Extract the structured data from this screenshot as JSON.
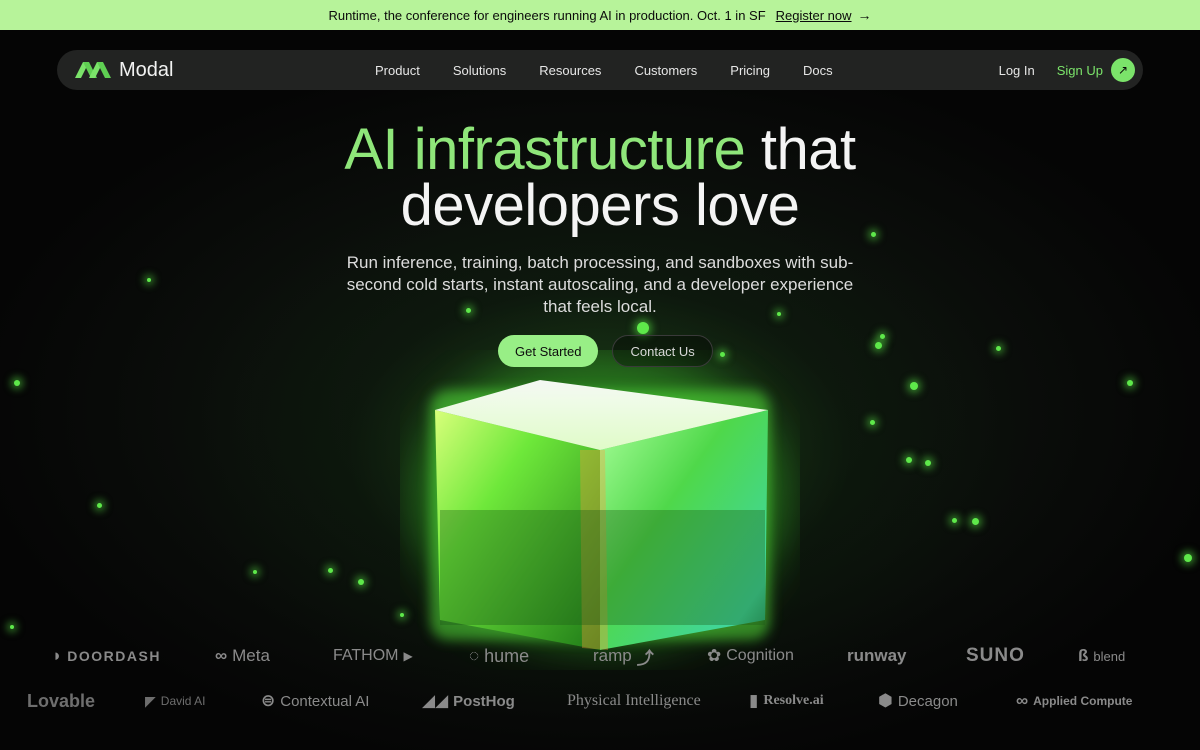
{
  "banner": {
    "text": "Runtime, the conference for engineers running AI in production. Oct. 1 in SF",
    "link": "Register now",
    "arrow_icon": "arrow-right-icon"
  },
  "nav": {
    "brand": "Modal",
    "links": [
      "Product",
      "Solutions",
      "Resources",
      "Customers",
      "Pricing",
      "Docs"
    ],
    "login": "Log In",
    "signup": "Sign Up"
  },
  "hero": {
    "title_accent": "AI infrastructure",
    "title_plain_1": "that",
    "title_plain_2": "developers love",
    "subtitle": "Run inference, training, batch processing, and sandboxes with sub-second cold starts, instant autoscaling, and a developer experience that feels local.",
    "primary_cta": "Get Started",
    "secondary_cta": "Contact Us"
  },
  "customers_row1": [
    "DOORDASH",
    "Meta",
    "FATHOM",
    "hume",
    "ramp",
    "Cognition",
    "runway",
    "SUNO",
    "blend"
  ],
  "customers_row2": [
    "Lovable",
    "David AI",
    "Contextual AI",
    "PostHog",
    "Physical Intelligence",
    "Resolve.ai",
    "Decagon",
    "Applied Compute"
  ],
  "colors": {
    "banner_bg": "#b7f39a",
    "accent_green": "#8fe67a",
    "button_green": "#98ef86",
    "nav_bg": "#222322"
  }
}
